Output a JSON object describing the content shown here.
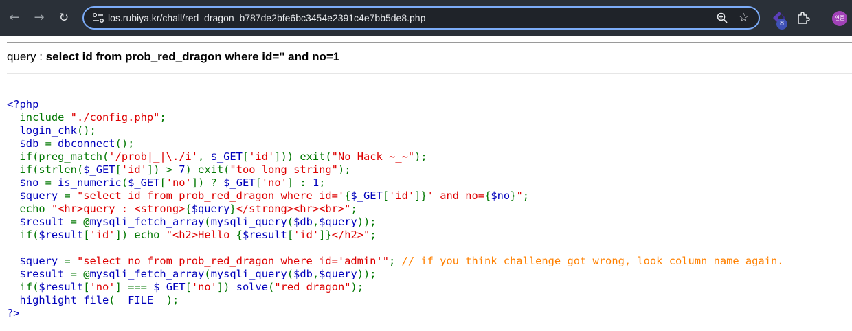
{
  "browser": {
    "url_host": "los.rubiya.kr",
    "url_path": "/chall/red_dragon_b787de2bfe6bc3454e2391c4e7bb5de8.php",
    "extension_badge": "8",
    "avatar_text": "연준",
    "icons": [
      "back-arrow-icon",
      "forward-arrow-icon",
      "reload-icon",
      "site-info-icon",
      "zoom-icon",
      "star-icon",
      "extension-icon",
      "puzzle-icon"
    ],
    "accent": "#7cacf8"
  },
  "page": {
    "query_label": "query : ",
    "query_value": "select id from prob_red_dragon where id='' and no=1"
  },
  "code_colors": {
    "keyword": "#007700",
    "default": "#0000bb",
    "string": "#dd0000",
    "comment": "#ff8000"
  },
  "code_lines": [
    [
      [
        "b",
        "<?php"
      ]
    ],
    [
      [
        "g",
        "  include "
      ],
      [
        "r",
        "\"./config.php\""
      ],
      [
        "g",
        ";"
      ]
    ],
    [
      [
        "b",
        "  login_chk"
      ],
      [
        "g",
        "();"
      ]
    ],
    [
      [
        "b",
        "  $db "
      ],
      [
        "g",
        "= "
      ],
      [
        "b",
        "dbconnect"
      ],
      [
        "g",
        "();"
      ]
    ],
    [
      [
        "g",
        "  if(preg_match"
      ],
      [
        "g",
        "("
      ],
      [
        "r",
        "'/prob|_|\\./i'"
      ],
      [
        "g",
        ", "
      ],
      [
        "b",
        "$_GET"
      ],
      [
        "g",
        "["
      ],
      [
        "r",
        "'id'"
      ],
      [
        "g",
        "])) exit("
      ],
      [
        "r",
        "\"No Hack ~_~\""
      ],
      [
        "g",
        ");"
      ]
    ],
    [
      [
        "g",
        "  if(strlen"
      ],
      [
        "g",
        "("
      ],
      [
        "b",
        "$_GET"
      ],
      [
        "g",
        "["
      ],
      [
        "r",
        "'id'"
      ],
      [
        "g",
        "]) > "
      ],
      [
        "b",
        "7"
      ],
      [
        "g",
        ") exit("
      ],
      [
        "r",
        "\"too long string\""
      ],
      [
        "g",
        ");"
      ]
    ],
    [
      [
        "b",
        "  $no "
      ],
      [
        "g",
        "= "
      ],
      [
        "b",
        "is_numeric"
      ],
      [
        "g",
        "("
      ],
      [
        "b",
        "$_GET"
      ],
      [
        "g",
        "["
      ],
      [
        "r",
        "'no'"
      ],
      [
        "g",
        "]) ? "
      ],
      [
        "b",
        "$_GET"
      ],
      [
        "g",
        "["
      ],
      [
        "r",
        "'no'"
      ],
      [
        "g",
        "] : "
      ],
      [
        "b",
        "1"
      ],
      [
        "g",
        ";"
      ]
    ],
    [
      [
        "b",
        "  $query "
      ],
      [
        "g",
        "= "
      ],
      [
        "r",
        "\"select id from prob_red_dragon where id='"
      ],
      [
        "g",
        "{"
      ],
      [
        "b",
        "$_GET"
      ],
      [
        "g",
        "["
      ],
      [
        "r",
        "'id'"
      ],
      [
        "g",
        "]}"
      ],
      [
        "r",
        "' and no="
      ],
      [
        "g",
        "{"
      ],
      [
        "b",
        "$no"
      ],
      [
        "g",
        "}"
      ],
      [
        "r",
        "\""
      ],
      [
        "g",
        ";"
      ]
    ],
    [
      [
        "g",
        "  echo "
      ],
      [
        "r",
        "\"<hr>query : <strong>"
      ],
      [
        "g",
        "{"
      ],
      [
        "b",
        "$query"
      ],
      [
        "g",
        "}"
      ],
      [
        "r",
        "</strong><hr><br>\""
      ],
      [
        "g",
        ";"
      ]
    ],
    [
      [
        "b",
        "  $result "
      ],
      [
        "g",
        "= @"
      ],
      [
        "b",
        "mysqli_fetch_array"
      ],
      [
        "g",
        "("
      ],
      [
        "b",
        "mysqli_query"
      ],
      [
        "g",
        "("
      ],
      [
        "b",
        "$db"
      ],
      [
        "g",
        ","
      ],
      [
        "b",
        "$query"
      ],
      [
        "g",
        "));"
      ]
    ],
    [
      [
        "g",
        "  if("
      ],
      [
        "b",
        "$result"
      ],
      [
        "g",
        "["
      ],
      [
        "r",
        "'id'"
      ],
      [
        "g",
        "]) echo "
      ],
      [
        "r",
        "\"<h2>Hello "
      ],
      [
        "g",
        "{"
      ],
      [
        "b",
        "$result"
      ],
      [
        "g",
        "["
      ],
      [
        "r",
        "'id'"
      ],
      [
        "g",
        "]}"
      ],
      [
        "r",
        "</h2>\""
      ],
      [
        "g",
        ";"
      ]
    ],
    [
      [
        "b",
        ""
      ]
    ],
    [
      [
        "b",
        "  $query "
      ],
      [
        "g",
        "= "
      ],
      [
        "r",
        "\"select no from prob_red_dragon where id='admin'\""
      ],
      [
        "g",
        "; "
      ],
      [
        "o",
        "// if you think challenge got wrong, look column name again."
      ]
    ],
    [
      [
        "b",
        "  $result "
      ],
      [
        "g",
        "= @"
      ],
      [
        "b",
        "mysqli_fetch_array"
      ],
      [
        "g",
        "("
      ],
      [
        "b",
        "mysqli_query"
      ],
      [
        "g",
        "("
      ],
      [
        "b",
        "$db"
      ],
      [
        "g",
        ","
      ],
      [
        "b",
        "$query"
      ],
      [
        "g",
        "));"
      ]
    ],
    [
      [
        "g",
        "  if("
      ],
      [
        "b",
        "$result"
      ],
      [
        "g",
        "["
      ],
      [
        "r",
        "'no'"
      ],
      [
        "g",
        "] === "
      ],
      [
        "b",
        "$_GET"
      ],
      [
        "g",
        "["
      ],
      [
        "r",
        "'no'"
      ],
      [
        "g",
        "]) "
      ],
      [
        "b",
        "solve"
      ],
      [
        "g",
        "("
      ],
      [
        "r",
        "\"red_dragon\""
      ],
      [
        "g",
        ");"
      ]
    ],
    [
      [
        "b",
        "  highlight_file"
      ],
      [
        "g",
        "("
      ],
      [
        "b",
        "__FILE__"
      ],
      [
        "g",
        ");"
      ]
    ],
    [
      [
        "b",
        "?>"
      ]
    ]
  ]
}
